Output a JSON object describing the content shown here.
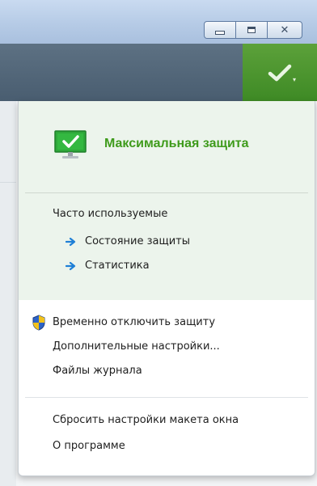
{
  "window": {
    "buttons": [
      {
        "name": "minimize",
        "icon": "minimize-icon"
      },
      {
        "name": "maximize",
        "icon": "maximize-icon"
      },
      {
        "name": "close",
        "icon": "close-icon",
        "glyph": "✕"
      }
    ]
  },
  "header": {
    "status_icon": "checkmark-icon",
    "status_color": "#4a9630",
    "caret": "▾"
  },
  "menu": {
    "protection": {
      "icon": "monitor-check-icon",
      "title": "Максимальная защита",
      "color": "#3f9b1c"
    },
    "frequent": {
      "heading": "Часто используемые",
      "items": [
        {
          "label": "Состояние защиты",
          "icon": "arrow-right-icon"
        },
        {
          "label": "Статистика",
          "icon": "arrow-right-icon"
        }
      ]
    },
    "actions": [
      {
        "label": "Временно отключить защиту",
        "icon": "uac-shield-icon"
      },
      {
        "label": "Дополнительные настройки..."
      },
      {
        "label": "Файлы журнала"
      }
    ],
    "misc": [
      {
        "label": "Сбросить настройки макета окна"
      },
      {
        "label": "О программе"
      }
    ]
  }
}
